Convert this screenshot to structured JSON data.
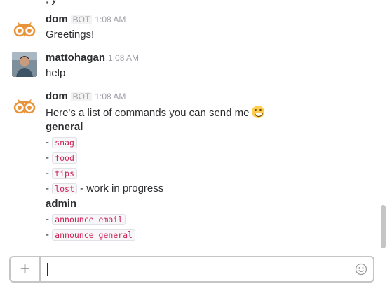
{
  "messages": [
    {
      "author": "dom",
      "badge": "BOT",
      "time": "1:08 AM",
      "avatar": "owl-icon",
      "lines": [
        "Greetings!"
      ]
    },
    {
      "author": "mattohagan",
      "time": "1:08 AM",
      "avatar": "user-photo",
      "lines": [
        "help"
      ]
    },
    {
      "author": "dom",
      "badge": "BOT",
      "time": "1:08 AM",
      "avatar": "owl-icon",
      "intro": "Here's a list of commands you can send me",
      "emoji": "grinning-face-icon",
      "sections": [
        {
          "title": "general",
          "commands": [
            {
              "prefix": "- ",
              "cmd": "snag",
              "suffix": ""
            },
            {
              "prefix": "- ",
              "cmd": "food",
              "suffix": ""
            },
            {
              "prefix": "- ",
              "cmd": "tips",
              "suffix": ""
            },
            {
              "prefix": "- ",
              "cmd": "lost",
              "suffix": " - work in progress"
            }
          ]
        },
        {
          "title": "admin",
          "commands": [
            {
              "prefix": "- ",
              "cmd": "announce email",
              "suffix": ""
            },
            {
              "prefix": "- ",
              "cmd": "announce general",
              "suffix": ""
            }
          ]
        }
      ]
    }
  ],
  "composer": {
    "plus_label": "+",
    "value": "",
    "emoji_button": "smiley-icon"
  },
  "colors": {
    "code_text": "#cc2255",
    "owl_orange": "#e8923a"
  }
}
